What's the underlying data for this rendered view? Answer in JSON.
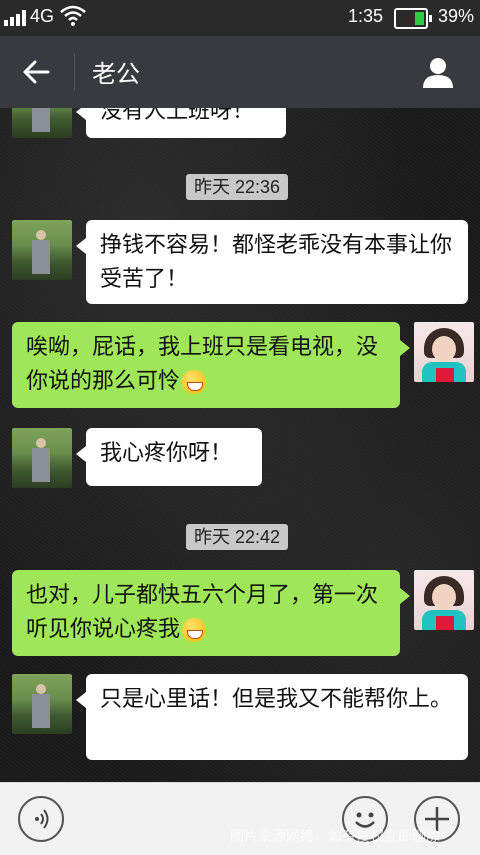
{
  "status_bar": {
    "network": "4G",
    "time": "1:35",
    "battery_percent": "39%",
    "battery_level": 0.39
  },
  "header": {
    "title": "老公",
    "back_icon": "back-arrow-icon",
    "profile_icon": "person-icon"
  },
  "messages": [
    {
      "side": "left",
      "text": "没有人上班呀！",
      "partial": true
    },
    {
      "type": "timestamp",
      "text": "昨天 22:36"
    },
    {
      "side": "left",
      "text": "挣钱不容易！都怪老乖没有本事让你受苦了！"
    },
    {
      "side": "right",
      "text": "唉呦，屁话，我上班只是看电视，没你说的那么可怜",
      "emoji": "grin-emoji"
    },
    {
      "side": "left",
      "text": "我心疼你呀！"
    },
    {
      "type": "timestamp",
      "text": "昨天 22:42"
    },
    {
      "side": "right",
      "text": "也对，儿子都快五六个月了，第一次听见你说心疼我",
      "emoji": "grin-emoji"
    },
    {
      "side": "left",
      "text": "只是心里话！但是我又不能帮你上。"
    }
  ],
  "input_bar": {
    "voice_icon": "voice-icon",
    "emoji_icon": "emoji-icon",
    "plus_icon": "plus-icon"
  },
  "watermark": "图片来源网络，如有侵权立即删除",
  "colors": {
    "titlebar": "#393a3f",
    "sent_bubble": "#9fe658",
    "received_bubble": "#ffffff"
  }
}
